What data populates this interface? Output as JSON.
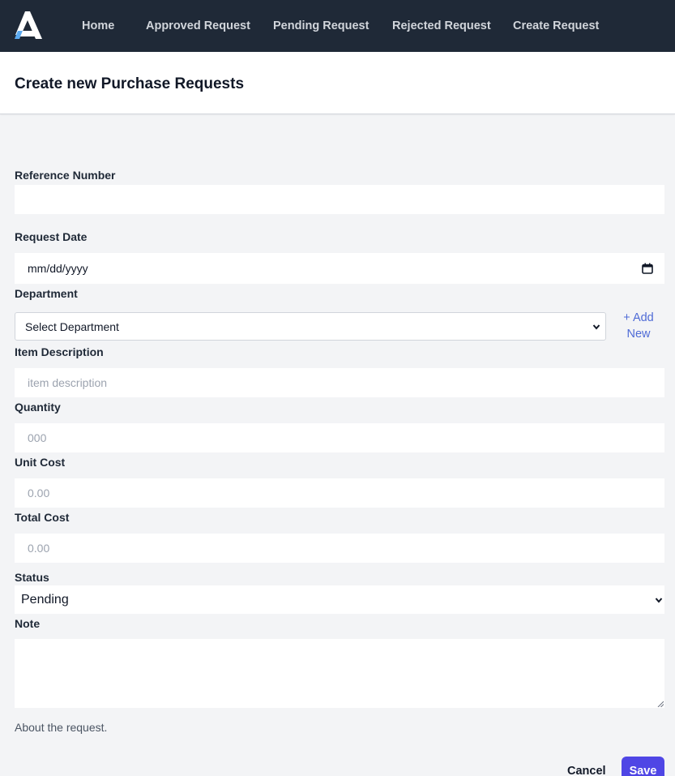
{
  "nav": {
    "items": [
      {
        "label": "Home"
      },
      {
        "label": "Approved Request"
      },
      {
        "label": "Pending Request"
      },
      {
        "label": "Rejected Request"
      },
      {
        "label": "Create Request"
      }
    ]
  },
  "header": {
    "title": "Create new Purchase Requests"
  },
  "form": {
    "reference_number": {
      "label": "Reference Number",
      "value": ""
    },
    "request_date": {
      "label": "Request Date",
      "placeholder": "mm/dd/yyyy"
    },
    "department": {
      "label": "Department",
      "selected": "Select Department",
      "add_new": "+ Add New"
    },
    "item_description": {
      "label": "Item Description",
      "placeholder": "item description"
    },
    "quantity": {
      "label": "Quantity",
      "placeholder": "000"
    },
    "unit_cost": {
      "label": "Unit Cost",
      "placeholder": "0.00"
    },
    "total_cost": {
      "label": "Total Cost",
      "placeholder": "0.00"
    },
    "status": {
      "label": "Status",
      "selected": "Pending"
    },
    "note": {
      "label": "Note",
      "value": "",
      "help": "About the request."
    }
  },
  "actions": {
    "cancel": "Cancel",
    "save": "Save"
  },
  "colors": {
    "nav_bg": "#1f2937",
    "accent": "#4f46e5",
    "link": "#4f6bd6"
  },
  "icons": {
    "logo": "brand-a-logo",
    "calendar": "calendar-icon",
    "chevron": "chevron-down-icon"
  }
}
